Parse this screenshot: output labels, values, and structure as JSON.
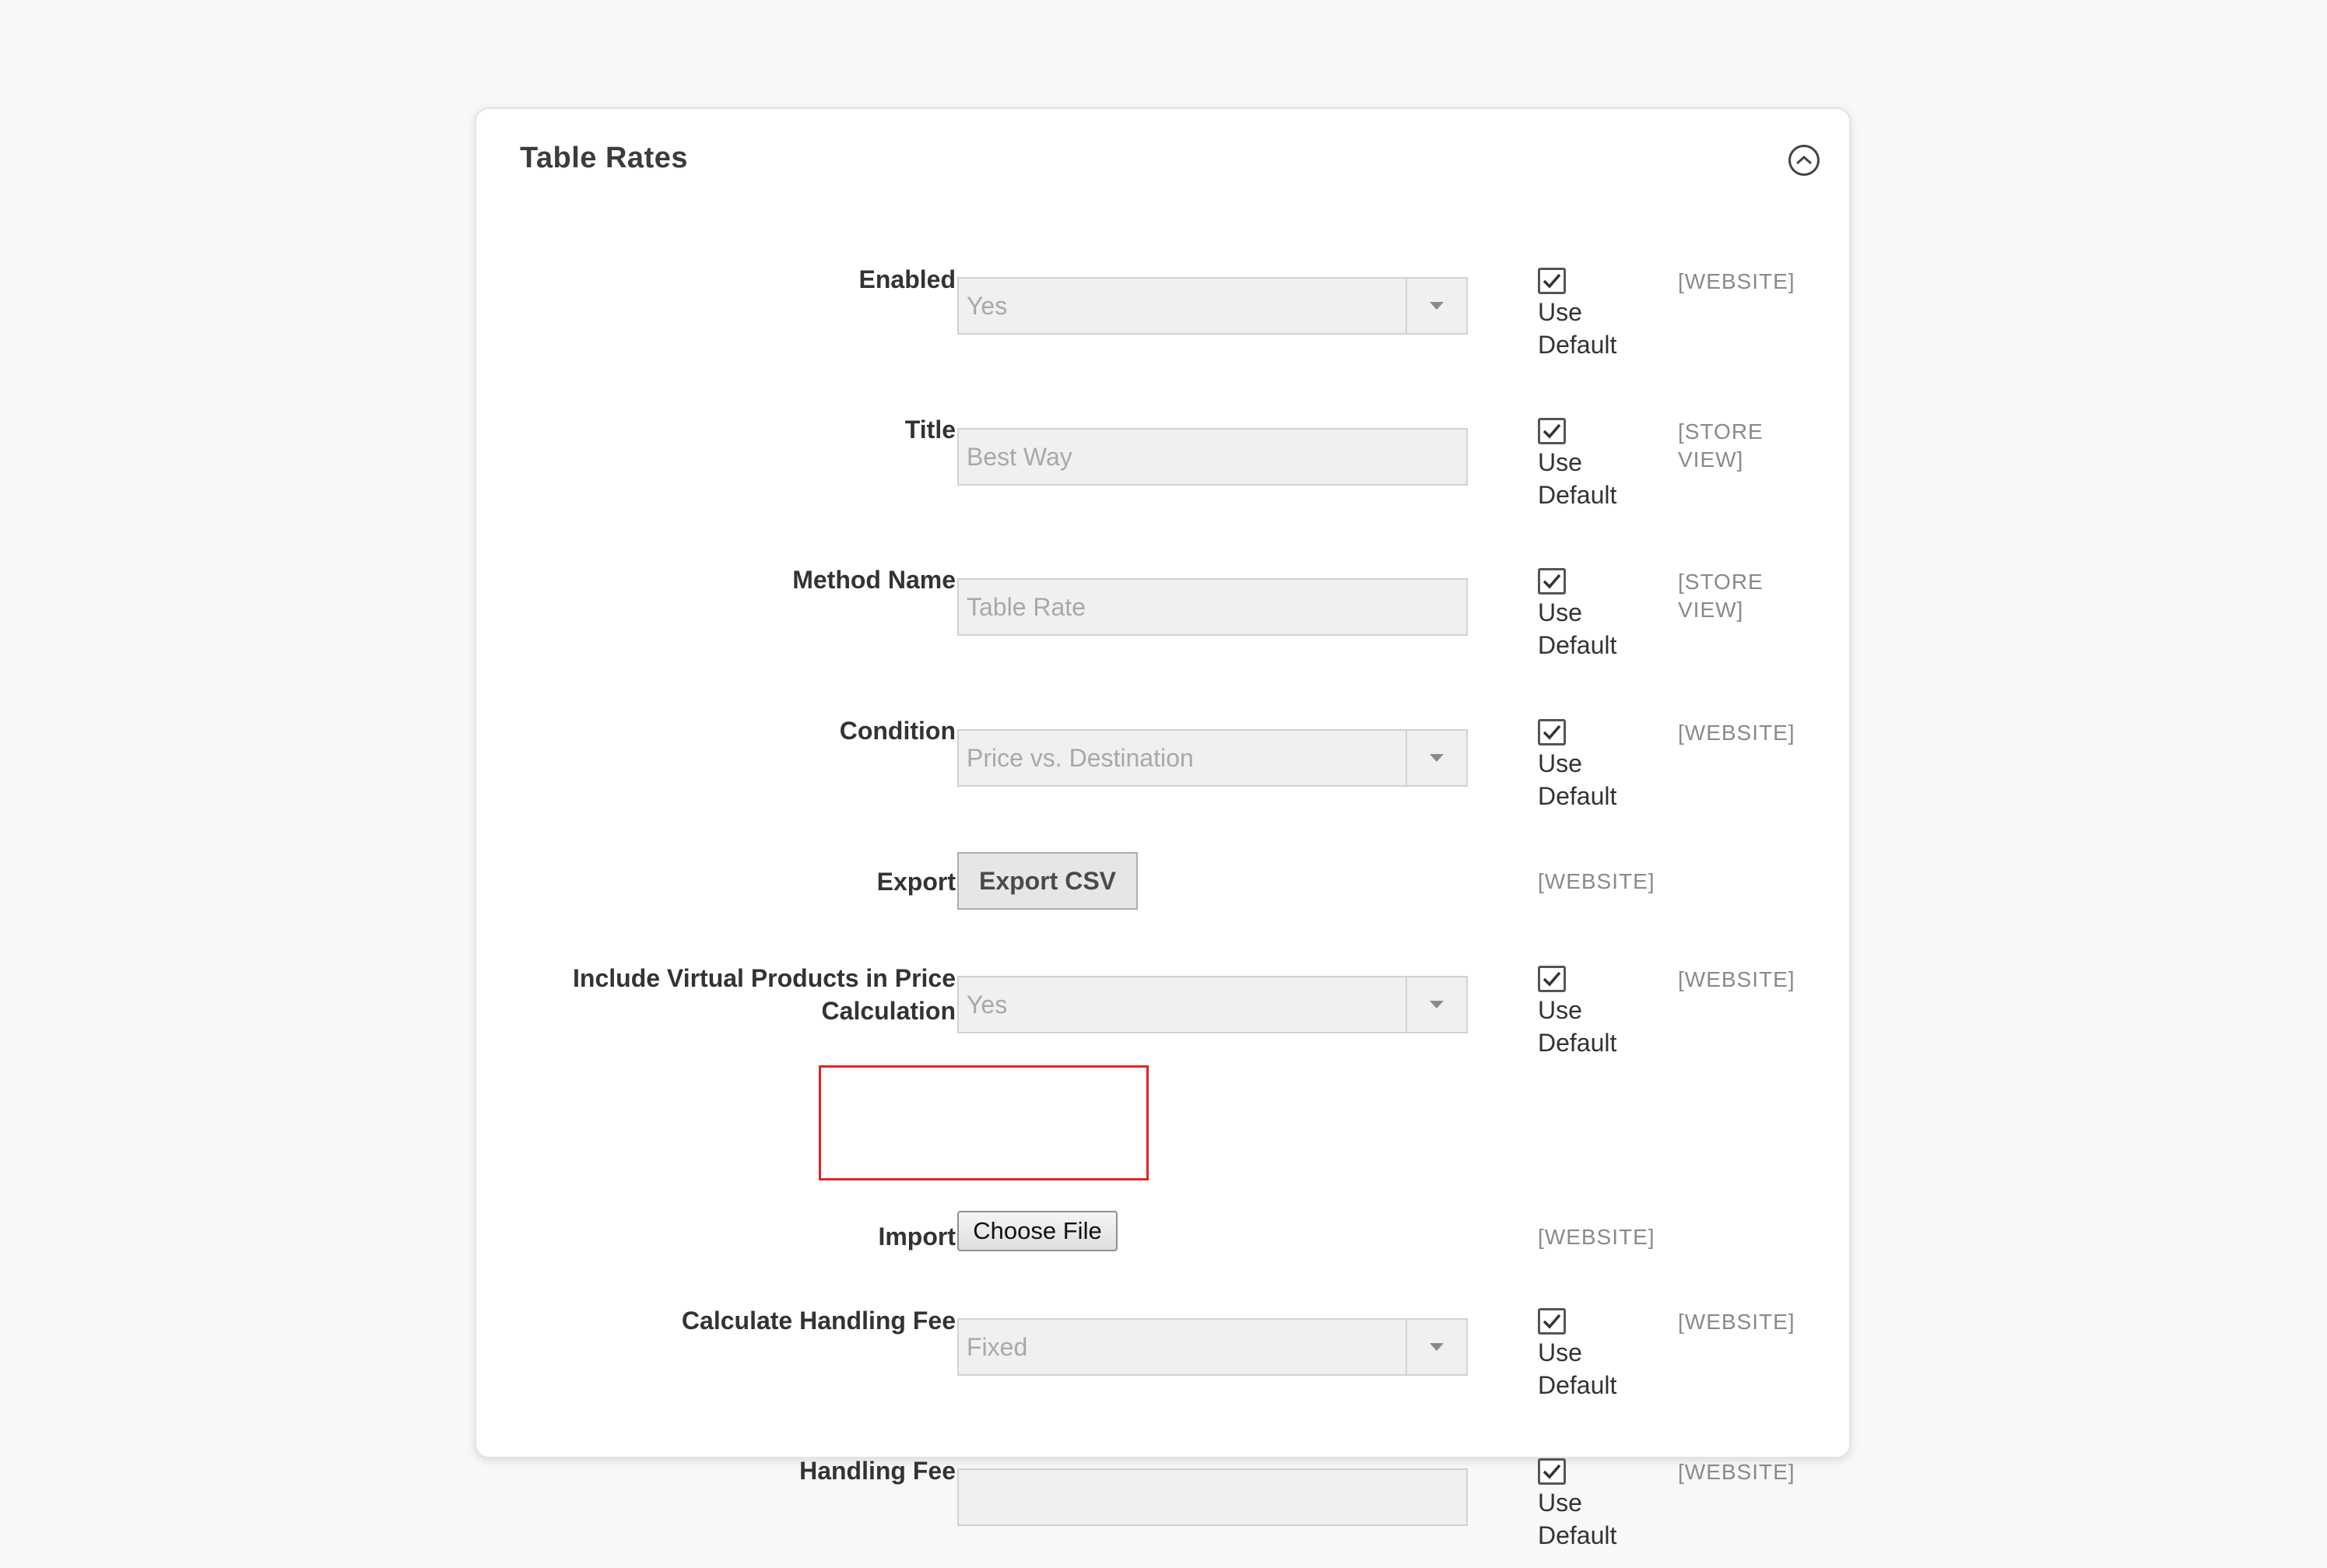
{
  "panel": {
    "title": "Table Rates"
  },
  "fields": {
    "enabled": {
      "label": "Enabled",
      "value": "Yes",
      "use_default_label": "Use Default",
      "scope": "[WEBSITE]"
    },
    "title": {
      "label": "Title",
      "value": "Best Way",
      "use_default_label": "Use Default",
      "scope": "[STORE VIEW]"
    },
    "method_name": {
      "label": "Method Name",
      "value": "Table Rate",
      "use_default_label": "Use Default",
      "scope": "[STORE VIEW]"
    },
    "condition": {
      "label": "Condition",
      "value": "Price vs. Destination",
      "use_default_label": "Use Default",
      "scope": "[WEBSITE]"
    },
    "export": {
      "label": "Export",
      "button_label": "Export CSV",
      "scope": "[WEBSITE]"
    },
    "include_virtual": {
      "label": "Include Virtual Products in Price Calculation",
      "value": "Yes",
      "use_default_label": "Use Default",
      "scope": "[WEBSITE]"
    },
    "import": {
      "label": "Import",
      "button_label": "Choose File",
      "scope": "[WEBSITE]"
    },
    "handling_fee_calc": {
      "label": "Calculate Handling Fee",
      "value": "Fixed",
      "use_default_label": "Use Default",
      "scope": "[WEBSITE]"
    },
    "handling_fee": {
      "label": "Handling Fee",
      "value": "",
      "use_default_label": "Use Default",
      "scope": "[WEBSITE]"
    }
  },
  "colors": {
    "highlight": "#e02424",
    "background": "#f8f8f8",
    "panel": "#ffffff"
  },
  "icons": {
    "collapse": "chevron-up-circle-icon",
    "checkbox": "checkmark-icon",
    "select": "triangle-down-icon"
  }
}
